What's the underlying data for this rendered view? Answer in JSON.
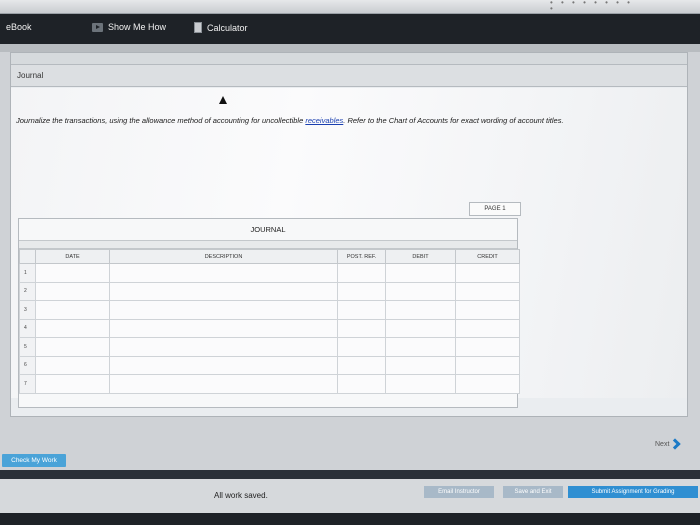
{
  "toolbar": {
    "ebook": "eBook",
    "show_me_how": "Show Me How",
    "calculator": "Calculator"
  },
  "panel": {
    "title": "Journal"
  },
  "instructions": {
    "before_link": "Journalize the transactions, using the allowance method of accounting for uncollectible ",
    "link": "receivables",
    "after_link": ". Refer to the Chart of Accounts for exact wording of account titles."
  },
  "journal": {
    "page_label": "PAGE 1",
    "title": "JOURNAL",
    "columns": [
      "DATE",
      "DESCRIPTION",
      "POST. REF.",
      "DEBIT",
      "CREDIT"
    ],
    "rows": [
      "1",
      "2",
      "3",
      "4",
      "5",
      "6",
      "7"
    ]
  },
  "buttons": {
    "check_my_work": "Check My Work",
    "next": "Next",
    "email_instructor": "Email Instructor",
    "save_and_exit": "Save and Exit",
    "submit": "Submit Assignment for Grading"
  },
  "status": {
    "saved": "All work saved."
  }
}
